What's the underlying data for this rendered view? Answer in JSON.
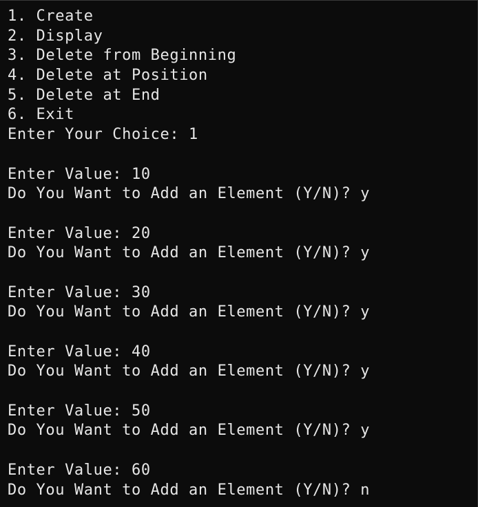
{
  "terminal": {
    "lines": [
      "1. Create",
      "2. Display",
      "3. Delete from Beginning",
      "4. Delete at Position",
      "5. Delete at End",
      "6. Exit",
      "Enter Your Choice: 1",
      "",
      "Enter Value: 10",
      "Do You Want to Add an Element (Y/N)? y",
      "",
      "Enter Value: 20",
      "Do You Want to Add an Element (Y/N)? y",
      "",
      "Enter Value: 30",
      "Do You Want to Add an Element (Y/N)? y",
      "",
      "Enter Value: 40",
      "Do You Want to Add an Element (Y/N)? y",
      "",
      "Enter Value: 50",
      "Do You Want to Add an Element (Y/N)? y",
      "",
      "Enter Value: 60",
      "Do You Want to Add an Element (Y/N)? n"
    ]
  }
}
